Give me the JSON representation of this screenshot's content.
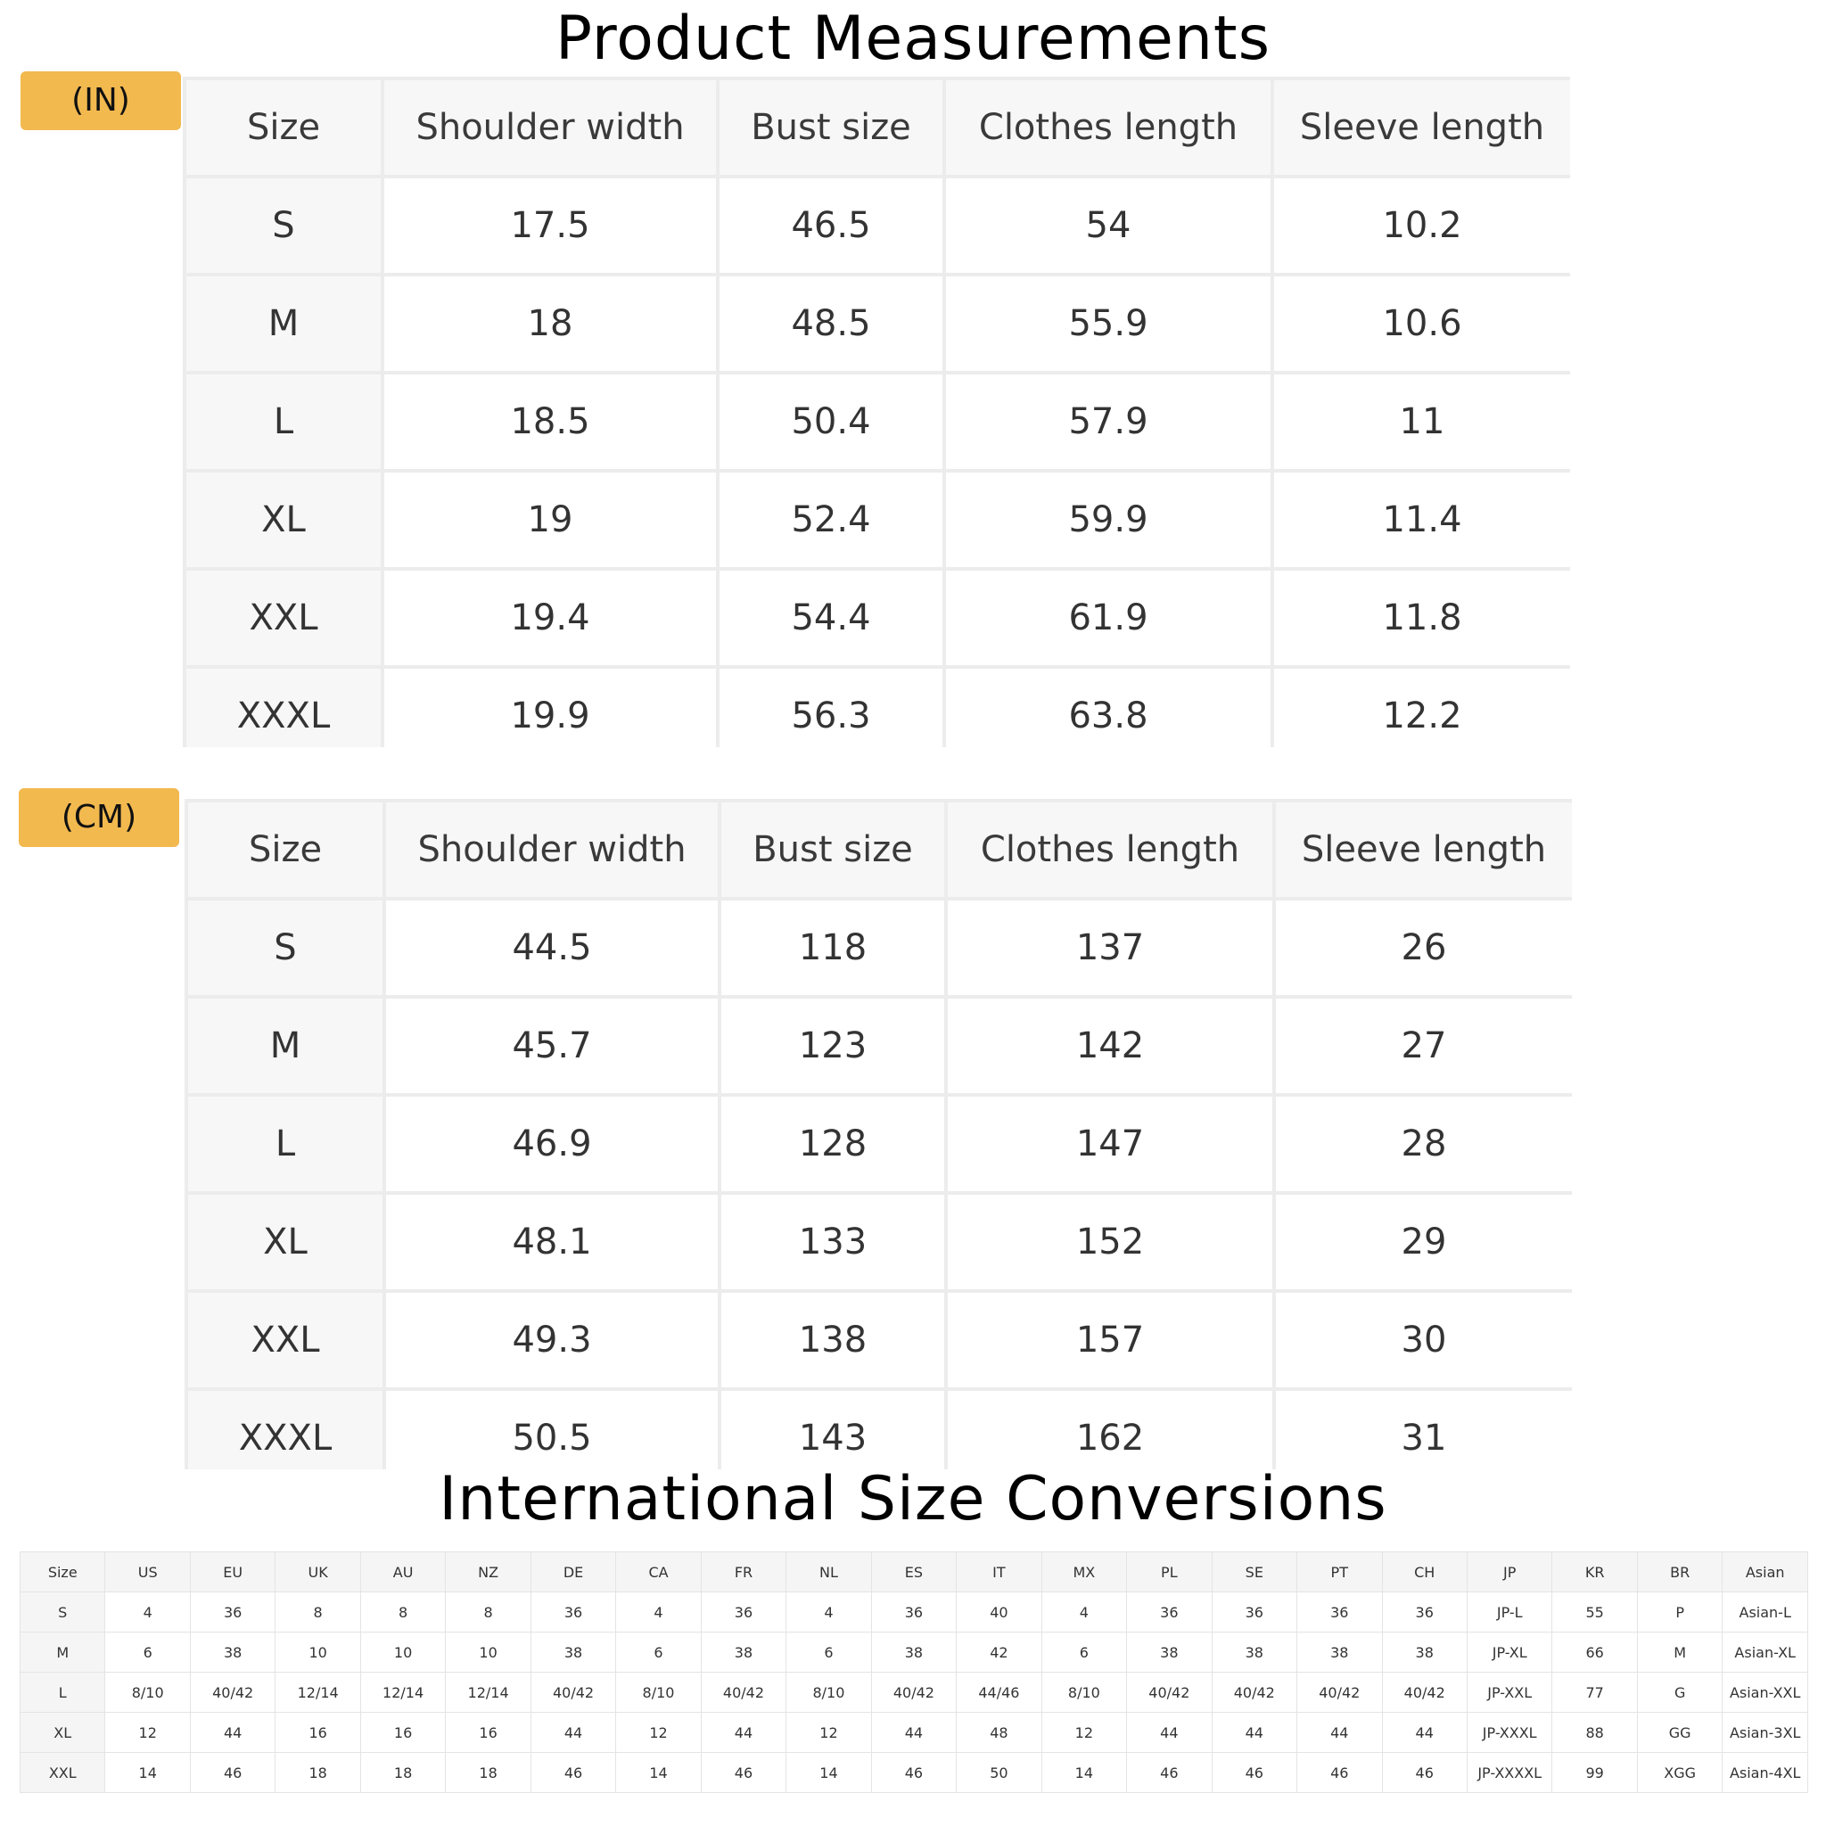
{
  "title": "Product Measurements",
  "conversion_title": "International Size Conversions",
  "tables": {
    "inches": {
      "unit_label": "(IN)",
      "headers": [
        "Size",
        "Shoulder width",
        "Bust size",
        "Clothes length",
        "Sleeve length"
      ],
      "rows": [
        [
          "S",
          "17.5",
          "46.5",
          "54",
          "10.2"
        ],
        [
          "M",
          "18",
          "48.5",
          "55.9",
          "10.6"
        ],
        [
          "L",
          "18.5",
          "50.4",
          "57.9",
          "11"
        ],
        [
          "XL",
          "19",
          "52.4",
          "59.9",
          "11.4"
        ],
        [
          "XXL",
          "19.4",
          "54.4",
          "61.9",
          "11.8"
        ],
        [
          "XXXL",
          "19.9",
          "56.3",
          "63.8",
          "12.2"
        ]
      ]
    },
    "centimeters": {
      "unit_label": "(CM)",
      "headers": [
        "Size",
        "Shoulder width",
        "Bust size",
        "Clothes length",
        "Sleeve length"
      ],
      "rows": [
        [
          "S",
          "44.5",
          "118",
          "137",
          "26"
        ],
        [
          "M",
          "45.7",
          "123",
          "142",
          "27"
        ],
        [
          "L",
          "46.9",
          "128",
          "147",
          "28"
        ],
        [
          "XL",
          "48.1",
          "133",
          "152",
          "29"
        ],
        [
          "XXL",
          "49.3",
          "138",
          "157",
          "30"
        ],
        [
          "XXXL",
          "50.5",
          "143",
          "162",
          "31"
        ]
      ]
    }
  },
  "conversion": {
    "headers": [
      "Size",
      "US",
      "EU",
      "UK",
      "AU",
      "NZ",
      "DE",
      "CA",
      "FR",
      "NL",
      "ES",
      "IT",
      "MX",
      "PL",
      "SE",
      "PT",
      "CH",
      "JP",
      "KR",
      "BR",
      "Asian"
    ],
    "rows": [
      [
        "S",
        "4",
        "36",
        "8",
        "8",
        "8",
        "36",
        "4",
        "36",
        "4",
        "36",
        "40",
        "4",
        "36",
        "36",
        "36",
        "36",
        "JP-L",
        "55",
        "P",
        "Asian-L"
      ],
      [
        "M",
        "6",
        "38",
        "10",
        "10",
        "10",
        "38",
        "6",
        "38",
        "6",
        "38",
        "42",
        "6",
        "38",
        "38",
        "38",
        "38",
        "JP-XL",
        "66",
        "M",
        "Asian-XL"
      ],
      [
        "L",
        "8/10",
        "40/42",
        "12/14",
        "12/14",
        "12/14",
        "40/42",
        "8/10",
        "40/42",
        "8/10",
        "40/42",
        "44/46",
        "8/10",
        "40/42",
        "40/42",
        "40/42",
        "40/42",
        "JP-XXL",
        "77",
        "G",
        "Asian-XXL"
      ],
      [
        "XL",
        "12",
        "44",
        "16",
        "16",
        "16",
        "44",
        "12",
        "44",
        "12",
        "44",
        "48",
        "12",
        "44",
        "44",
        "44",
        "44",
        "JP-XXXL",
        "88",
        "GG",
        "Asian-3XL"
      ],
      [
        "XXL",
        "14",
        "46",
        "18",
        "18",
        "18",
        "46",
        "14",
        "46",
        "14",
        "46",
        "50",
        "14",
        "46",
        "46",
        "46",
        "46",
        "JP-XXXXL",
        "99",
        "XGG",
        "Asian-4XL"
      ]
    ]
  },
  "colors": {
    "badge": "#f2b94f",
    "header_bg": "#f7f7f7",
    "grid_line": "#ececec"
  }
}
